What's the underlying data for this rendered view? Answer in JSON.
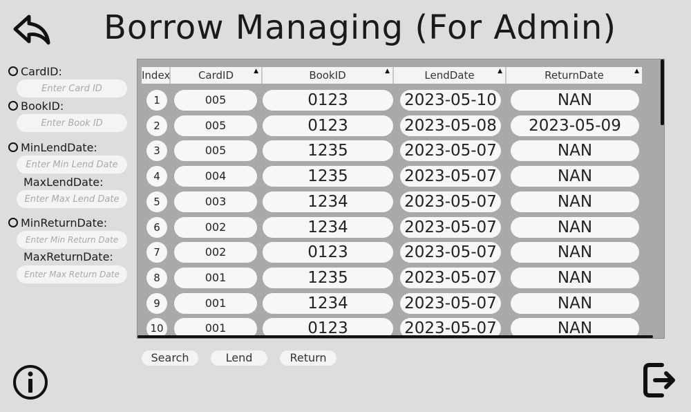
{
  "header": {
    "title": "Borrow Managing (For Admin)"
  },
  "icons": {
    "back": "back-arrow-icon",
    "info": "info-icon",
    "logout": "logout-icon"
  },
  "filters": {
    "card_id": {
      "label": "CardID:",
      "placeholder": "Enter Card ID"
    },
    "book_id": {
      "label": "BookID:",
      "placeholder": "Enter Book ID"
    },
    "lend_date": {
      "min_label": "MinLendDate:",
      "min_placeholder": "Enter Min Lend Date",
      "max_label": "MaxLendDate:",
      "max_placeholder": "Enter Max Lend Date"
    },
    "return_date": {
      "min_label": "MinReturnDate:",
      "min_placeholder": "Enter Min Return Date",
      "max_label": "MaxReturnDate:",
      "max_placeholder": "Enter Max Return Date"
    }
  },
  "table": {
    "columns": [
      "Index",
      "CardID",
      "BookID",
      "LendDate",
      "ReturnDate"
    ],
    "rows": [
      {
        "index": "1",
        "card_id": "005",
        "book_id": "0123",
        "lend_date": "2023-05-10",
        "return_date": "NAN"
      },
      {
        "index": "2",
        "card_id": "005",
        "book_id": "0123",
        "lend_date": "2023-05-08",
        "return_date": "2023-05-09"
      },
      {
        "index": "3",
        "card_id": "005",
        "book_id": "1235",
        "lend_date": "2023-05-07",
        "return_date": "NAN"
      },
      {
        "index": "4",
        "card_id": "004",
        "book_id": "1235",
        "lend_date": "2023-05-07",
        "return_date": "NAN"
      },
      {
        "index": "5",
        "card_id": "003",
        "book_id": "1234",
        "lend_date": "2023-05-07",
        "return_date": "NAN"
      },
      {
        "index": "6",
        "card_id": "002",
        "book_id": "1234",
        "lend_date": "2023-05-07",
        "return_date": "NAN"
      },
      {
        "index": "7",
        "card_id": "002",
        "book_id": "0123",
        "lend_date": "2023-05-07",
        "return_date": "NAN"
      },
      {
        "index": "8",
        "card_id": "001",
        "book_id": "1235",
        "lend_date": "2023-05-07",
        "return_date": "NAN"
      },
      {
        "index": "9",
        "card_id": "001",
        "book_id": "1234",
        "lend_date": "2023-05-07",
        "return_date": "NAN"
      },
      {
        "index": "10",
        "card_id": "001",
        "book_id": "0123",
        "lend_date": "2023-05-07",
        "return_date": "NAN"
      }
    ]
  },
  "actions": {
    "search": "Search",
    "lend": "Lend",
    "return": "Return"
  }
}
